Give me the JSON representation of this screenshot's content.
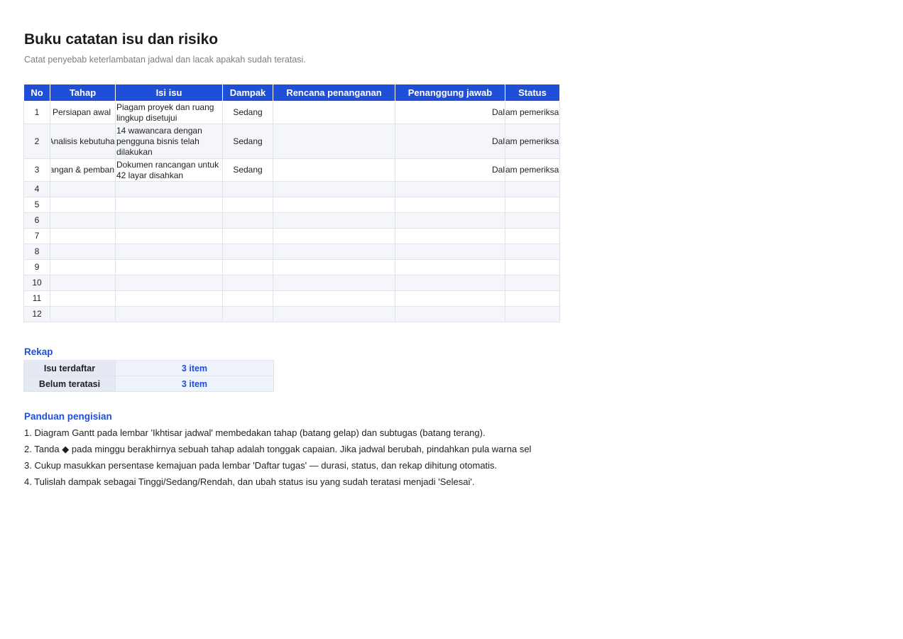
{
  "title": "Buku catatan isu dan risiko",
  "subtitle": "Catat penyebab keterlambatan jadwal dan lacak apakah sudah teratasi.",
  "table": {
    "headers": [
      "No",
      "Tahap",
      "Isi isu",
      "Dampak",
      "Rencana penanganan",
      "Penanggung jawab",
      "Status"
    ],
    "rows": [
      {
        "no": "1",
        "stage": "Persiapan awal",
        "issue": "Piagam proyek dan ruang lingkup disetujui",
        "impact": "Sedang",
        "plan": "",
        "owner": "Dal",
        "status": "am pemeriksa"
      },
      {
        "no": "2",
        "stage": "Analisis kebutuhan",
        "issue": "14 wawancara dengan pengguna bisnis telah dilakukan",
        "impact": "Sedang",
        "plan": "",
        "owner": "Dal",
        "status": "am pemeriksa"
      },
      {
        "no": "3",
        "stage": "Rancangan & pembangunan",
        "issue": "Dokumen rancangan untuk 42 layar disahkan",
        "impact": "Sedang",
        "plan": "",
        "owner": "Dal",
        "status": "am pemeriksa"
      }
    ],
    "blank_rows": [
      "4",
      "5",
      "6",
      "7",
      "8",
      "9",
      "10",
      "11",
      "12"
    ]
  },
  "summary": {
    "heading": "Rekap",
    "rows": [
      {
        "label": "Isu terdaftar",
        "value": "3 item"
      },
      {
        "label": "Belum teratasi",
        "value": "3 item"
      }
    ]
  },
  "guide": {
    "heading": "Panduan pengisian",
    "lines": [
      "1. Diagram Gantt pada lembar 'Ikhtisar jadwal' membedakan tahap (batang gelap) dan subtugas (batang terang).",
      "2. Tanda ◆ pada minggu berakhirnya sebuah tahap adalah tonggak capaian. Jika jadwal berubah, pindahkan pula warna sel",
      "3. Cukup masukkan persentase kemajuan pada lembar 'Daftar tugas' — durasi, status, dan rekap dihitung otomatis.",
      "4. Tulislah dampak sebagai Tinggi/Sedang/Rendah, dan ubah status isu yang sudah teratasi menjadi 'Selesai'."
    ]
  },
  "colors": {
    "header_blue": "#1f4fd6",
    "accent_text": "#1f4fd6",
    "grid_line": "#dfe3ea"
  }
}
